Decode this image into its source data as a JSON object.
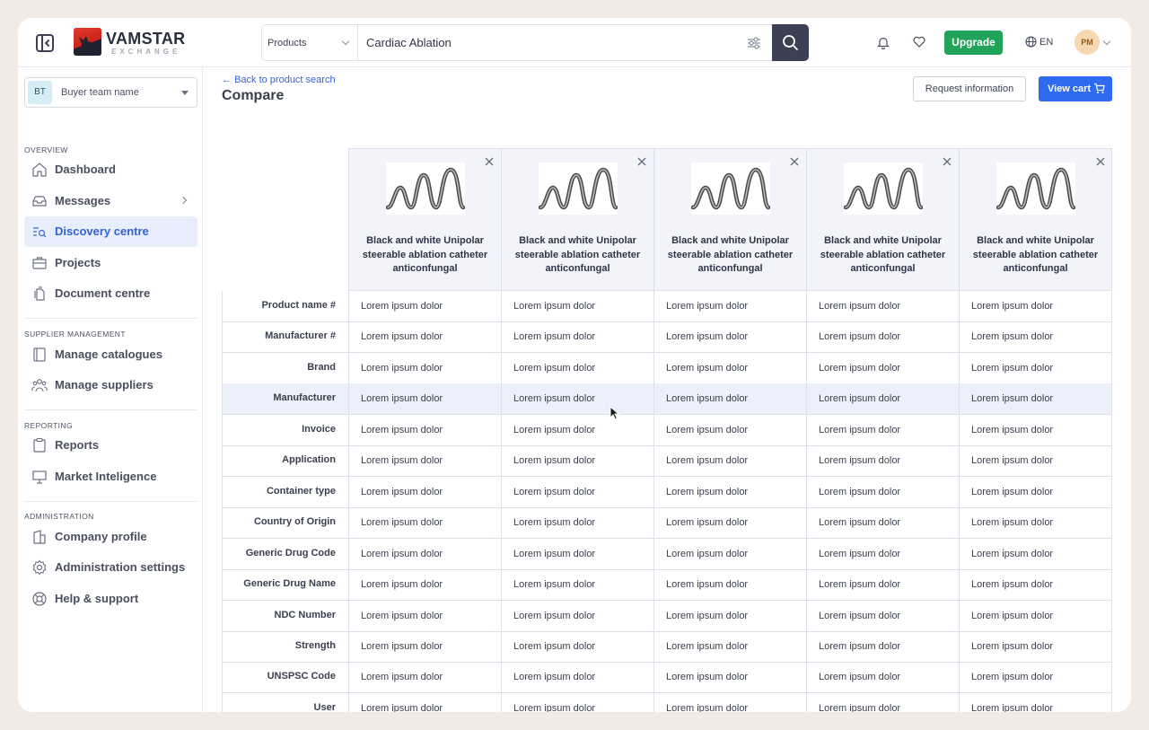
{
  "brand": {
    "name": "VAMSTAR",
    "sub": "EXCHANGE"
  },
  "search": {
    "category": "Products",
    "query": "Cardiac Ablation"
  },
  "header": {
    "upgrade_label": "Upgrade",
    "language": "EN",
    "user_initials": "PM"
  },
  "sidebar": {
    "team": {
      "initials": "BT",
      "placeholder": "Buyer team name"
    },
    "sections": [
      {
        "title": "OVERVIEW",
        "items": [
          {
            "label": "Dashboard",
            "icon": "home-icon"
          },
          {
            "label": "Messages",
            "icon": "inbox-icon"
          },
          {
            "label": "Discovery centre",
            "icon": "search-list-icon",
            "active": true
          },
          {
            "label": "Projects",
            "icon": "briefcase-icon"
          },
          {
            "label": "Document centre",
            "icon": "documents-icon"
          }
        ]
      },
      {
        "title": "SUPPLIER MANAGEMENT",
        "items": [
          {
            "label": "Manage catalogues",
            "icon": "catalogue-icon"
          },
          {
            "label": "Manage suppliers",
            "icon": "people-icon"
          }
        ]
      },
      {
        "title": "REPORTING",
        "items": [
          {
            "label": "Reports",
            "icon": "clipboard-icon"
          },
          {
            "label": "Market Inteligence",
            "icon": "presentation-icon"
          }
        ]
      },
      {
        "title": "ADMINISTRATION",
        "items": [
          {
            "label": "Company profile",
            "icon": "building-icon"
          },
          {
            "label": "Administration settings",
            "icon": "gear-icon"
          },
          {
            "label": "Help & support",
            "icon": "lifebuoy-icon"
          }
        ]
      }
    ]
  },
  "page": {
    "back_label": "Back to product search",
    "title": "Compare",
    "request_label": "Request information",
    "cart_label": "View cart"
  },
  "compare": {
    "products": [
      "Black and white Unipolar steerable ablation catheter anticonfungal",
      "Black and white Unipolar steerable ablation catheter anticonfungal",
      "Black and white Unipolar steerable ablation catheter anticonfungal",
      "Black and white Unipolar steerable ablation catheter anticonfungal",
      "Black and white Unipolar steerable ablation catheter anticonfungal"
    ],
    "rows": [
      {
        "label": "Product name #",
        "values": [
          "Lorem ipsum dolor",
          "Lorem ipsum dolor",
          "Lorem ipsum dolor",
          "Lorem ipsum dolor",
          "Lorem ipsum dolor"
        ]
      },
      {
        "label": "Manufacturer #",
        "values": [
          "Lorem ipsum dolor",
          "Lorem ipsum dolor",
          "Lorem ipsum dolor",
          "Lorem ipsum dolor",
          "Lorem ipsum dolor"
        ]
      },
      {
        "label": "Brand",
        "values": [
          "Lorem ipsum dolor",
          "Lorem ipsum dolor",
          "Lorem ipsum dolor",
          "Lorem ipsum dolor",
          "Lorem ipsum dolor"
        ]
      },
      {
        "label": "Manufacturer",
        "values": [
          "Lorem ipsum dolor",
          "Lorem ipsum dolor",
          "Lorem ipsum dolor",
          "Lorem ipsum dolor",
          "Lorem ipsum dolor"
        ],
        "highlighted": true
      },
      {
        "label": "Invoice",
        "values": [
          "Lorem ipsum dolor",
          "Lorem ipsum dolor",
          "Lorem ipsum dolor",
          "Lorem ipsum dolor",
          "Lorem ipsum dolor"
        ]
      },
      {
        "label": "Application",
        "values": [
          "Lorem ipsum dolor",
          "Lorem ipsum dolor",
          "Lorem ipsum dolor",
          "Lorem ipsum dolor",
          "Lorem ipsum dolor"
        ]
      },
      {
        "label": "Container type",
        "values": [
          "Lorem ipsum dolor",
          "Lorem ipsum dolor",
          "Lorem ipsum dolor",
          "Lorem ipsum dolor",
          "Lorem ipsum dolor"
        ]
      },
      {
        "label": "Country of Origin",
        "values": [
          "Lorem ipsum dolor",
          "Lorem ipsum dolor",
          "Lorem ipsum dolor",
          "Lorem ipsum dolor",
          "Lorem ipsum dolor"
        ]
      },
      {
        "label": "Generic Drug Code",
        "values": [
          "Lorem ipsum dolor",
          "Lorem ipsum dolor",
          "Lorem ipsum dolor",
          "Lorem ipsum dolor",
          "Lorem ipsum dolor"
        ]
      },
      {
        "label": "Generic Drug Name",
        "values": [
          "Lorem ipsum dolor",
          "Lorem ipsum dolor",
          "Lorem ipsum dolor",
          "Lorem ipsum dolor",
          "Lorem ipsum dolor"
        ]
      },
      {
        "label": "NDC Number",
        "values": [
          "Lorem ipsum dolor",
          "Lorem ipsum dolor",
          "Lorem ipsum dolor",
          "Lorem ipsum dolor",
          "Lorem ipsum dolor"
        ]
      },
      {
        "label": "Strength",
        "values": [
          "Lorem ipsum dolor",
          "Lorem ipsum dolor",
          "Lorem ipsum dolor",
          "Lorem ipsum dolor",
          "Lorem ipsum dolor"
        ]
      },
      {
        "label": "UNSPSC Code",
        "values": [
          "Lorem ipsum dolor",
          "Lorem ipsum dolor",
          "Lorem ipsum dolor",
          "Lorem ipsum dolor",
          "Lorem ipsum dolor"
        ]
      },
      {
        "label": "User",
        "values": [
          "Lorem ipsum dolor",
          "Lorem ipsum dolor",
          "Lorem ipsum dolor",
          "Lorem ipsum dolor",
          "Lorem ipsum dolor"
        ]
      }
    ]
  },
  "colors": {
    "accent": "#2f6bf0",
    "upgrade": "#22a35a",
    "active_nav_bg": "#e8eefb",
    "highlight_row": "#ebf0fa",
    "page_bg": "#f3ebe3"
  }
}
